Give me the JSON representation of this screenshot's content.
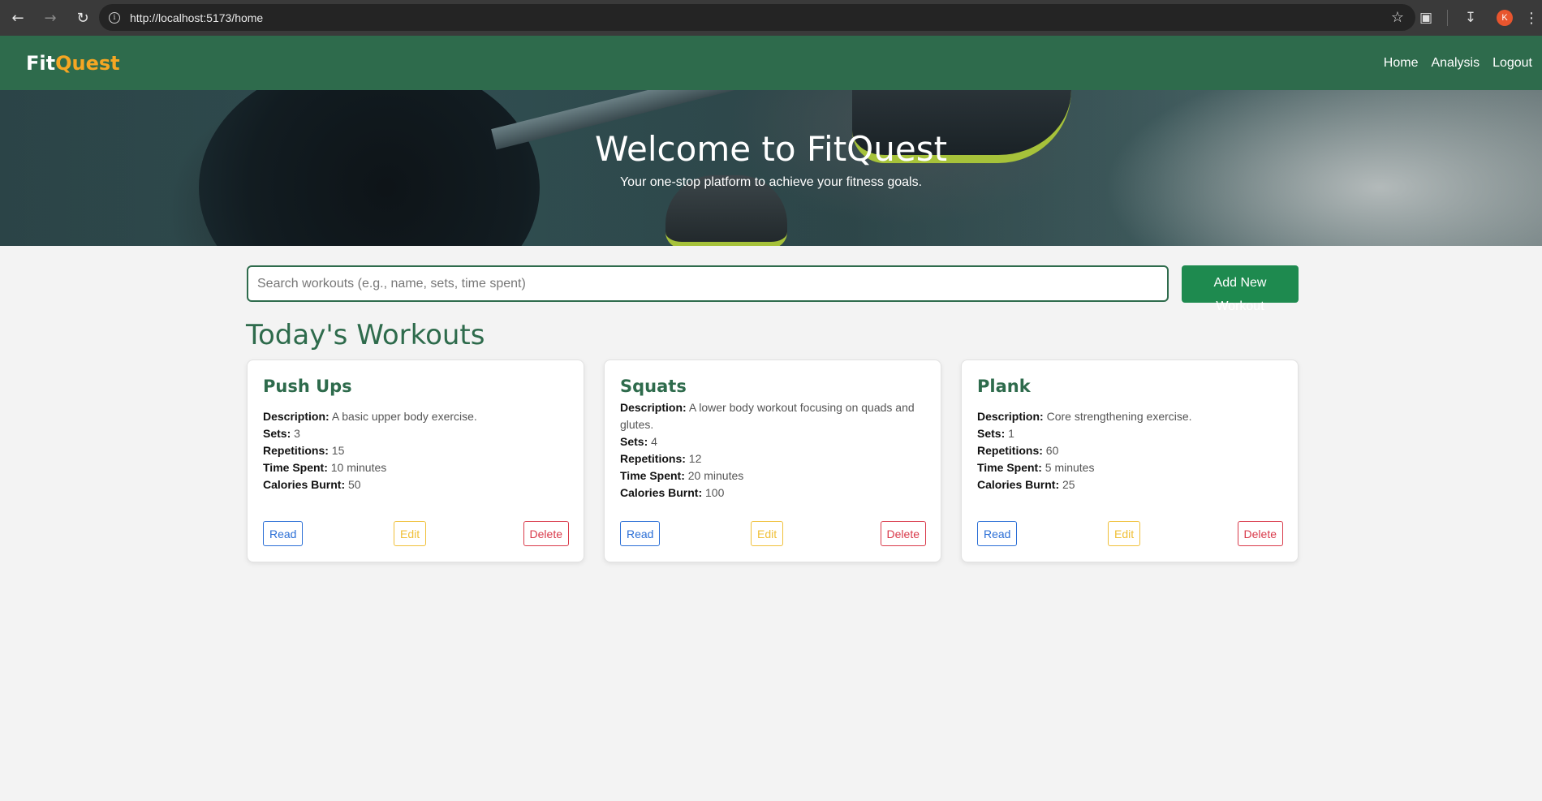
{
  "browser": {
    "url": "http://localhost:5173/home",
    "profile_initial": "K"
  },
  "app": {
    "brand_part1": "Fit",
    "brand_part2": "Quest",
    "nav": [
      "Home",
      "Analysis",
      "Logout"
    ]
  },
  "hero": {
    "title": "Welcome to FitQuest",
    "subtitle": "Your one-stop platform to achieve your fitness goals."
  },
  "search": {
    "placeholder": "Search workouts (e.g., name, sets, time spent)",
    "add_label_line1": "Add New",
    "add_label_line2": "Workout"
  },
  "section_title": "Today's Workouts",
  "labels": {
    "description": "Description:",
    "sets": "Sets:",
    "repetitions": "Repetitions:",
    "time_spent": "Time Spent:",
    "calories": "Calories Burnt:",
    "read": "Read",
    "edit": "Edit",
    "delete": "Delete"
  },
  "workouts": [
    {
      "name": "Push Ups",
      "description": "A basic upper body exercise.",
      "sets": "3",
      "repetitions": "15",
      "time_spent": "10 minutes",
      "calories": "50"
    },
    {
      "name": "Squats",
      "description": "A lower body workout focusing on quads and glutes.",
      "sets": "4",
      "repetitions": "12",
      "time_spent": "20 minutes",
      "calories": "100"
    },
    {
      "name": "Plank",
      "description": "Core strengthening exercise.",
      "sets": "1",
      "repetitions": "60",
      "time_spent": "5 minutes",
      "calories": "25"
    }
  ],
  "colors": {
    "primary": "#2e6b4c",
    "accent": "#f5a623",
    "button_green": "#1e8a4f",
    "read": "#2b6fd6",
    "edit": "#f0c039",
    "delete": "#d93a4a"
  }
}
